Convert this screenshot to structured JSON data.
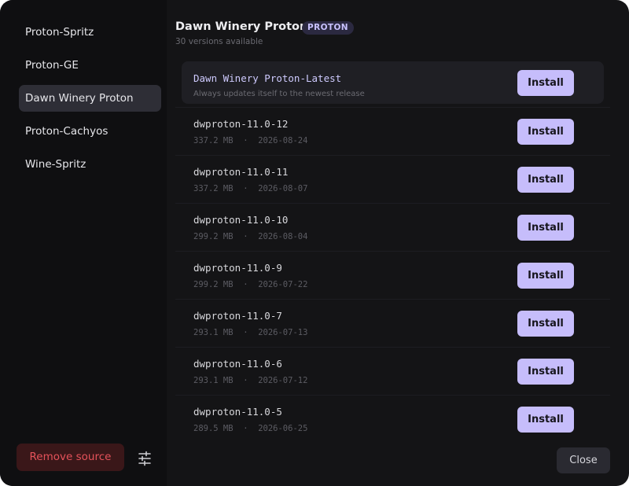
{
  "sidebar": {
    "items": [
      {
        "label": "Proton-Spritz"
      },
      {
        "label": "Proton-GE"
      },
      {
        "label": "Dawn Winery Proton"
      },
      {
        "label": "Proton-Cachyos"
      },
      {
        "label": "Wine-Spritz"
      }
    ],
    "selected_index": 2,
    "remove_label": "Remove source",
    "settings_icon": "sliders-icon"
  },
  "header": {
    "title": "Dawn Winery Proton",
    "badge": "PROTON",
    "subtitle": "30 versions available"
  },
  "featured": {
    "name": "Dawn Winery Proton-Latest",
    "description": "Always updates itself to the newest release",
    "install_label": "Install"
  },
  "versions": [
    {
      "name": "dwproton-11.0-12",
      "size": "337.2 MB",
      "date": "2026-08-24",
      "install_label": "Install"
    },
    {
      "name": "dwproton-11.0-11",
      "size": "337.2 MB",
      "date": "2026-08-07",
      "install_label": "Install"
    },
    {
      "name": "dwproton-11.0-10",
      "size": "299.2 MB",
      "date": "2026-08-04",
      "install_label": "Install"
    },
    {
      "name": "dwproton-11.0-9",
      "size": "299.2 MB",
      "date": "2026-07-22",
      "install_label": "Install"
    },
    {
      "name": "dwproton-11.0-7",
      "size": "293.1 MB",
      "date": "2026-07-13",
      "install_label": "Install"
    },
    {
      "name": "dwproton-11.0-6",
      "size": "293.1 MB",
      "date": "2026-07-12",
      "install_label": "Install"
    },
    {
      "name": "dwproton-11.0-5",
      "size": "289.5 MB",
      "date": "2026-06-25",
      "install_label": "Install"
    }
  ],
  "footer": {
    "close_label": "Close"
  },
  "colors": {
    "accent": "#c6bdfb",
    "danger": "#e5525a",
    "background": "#141416"
  }
}
